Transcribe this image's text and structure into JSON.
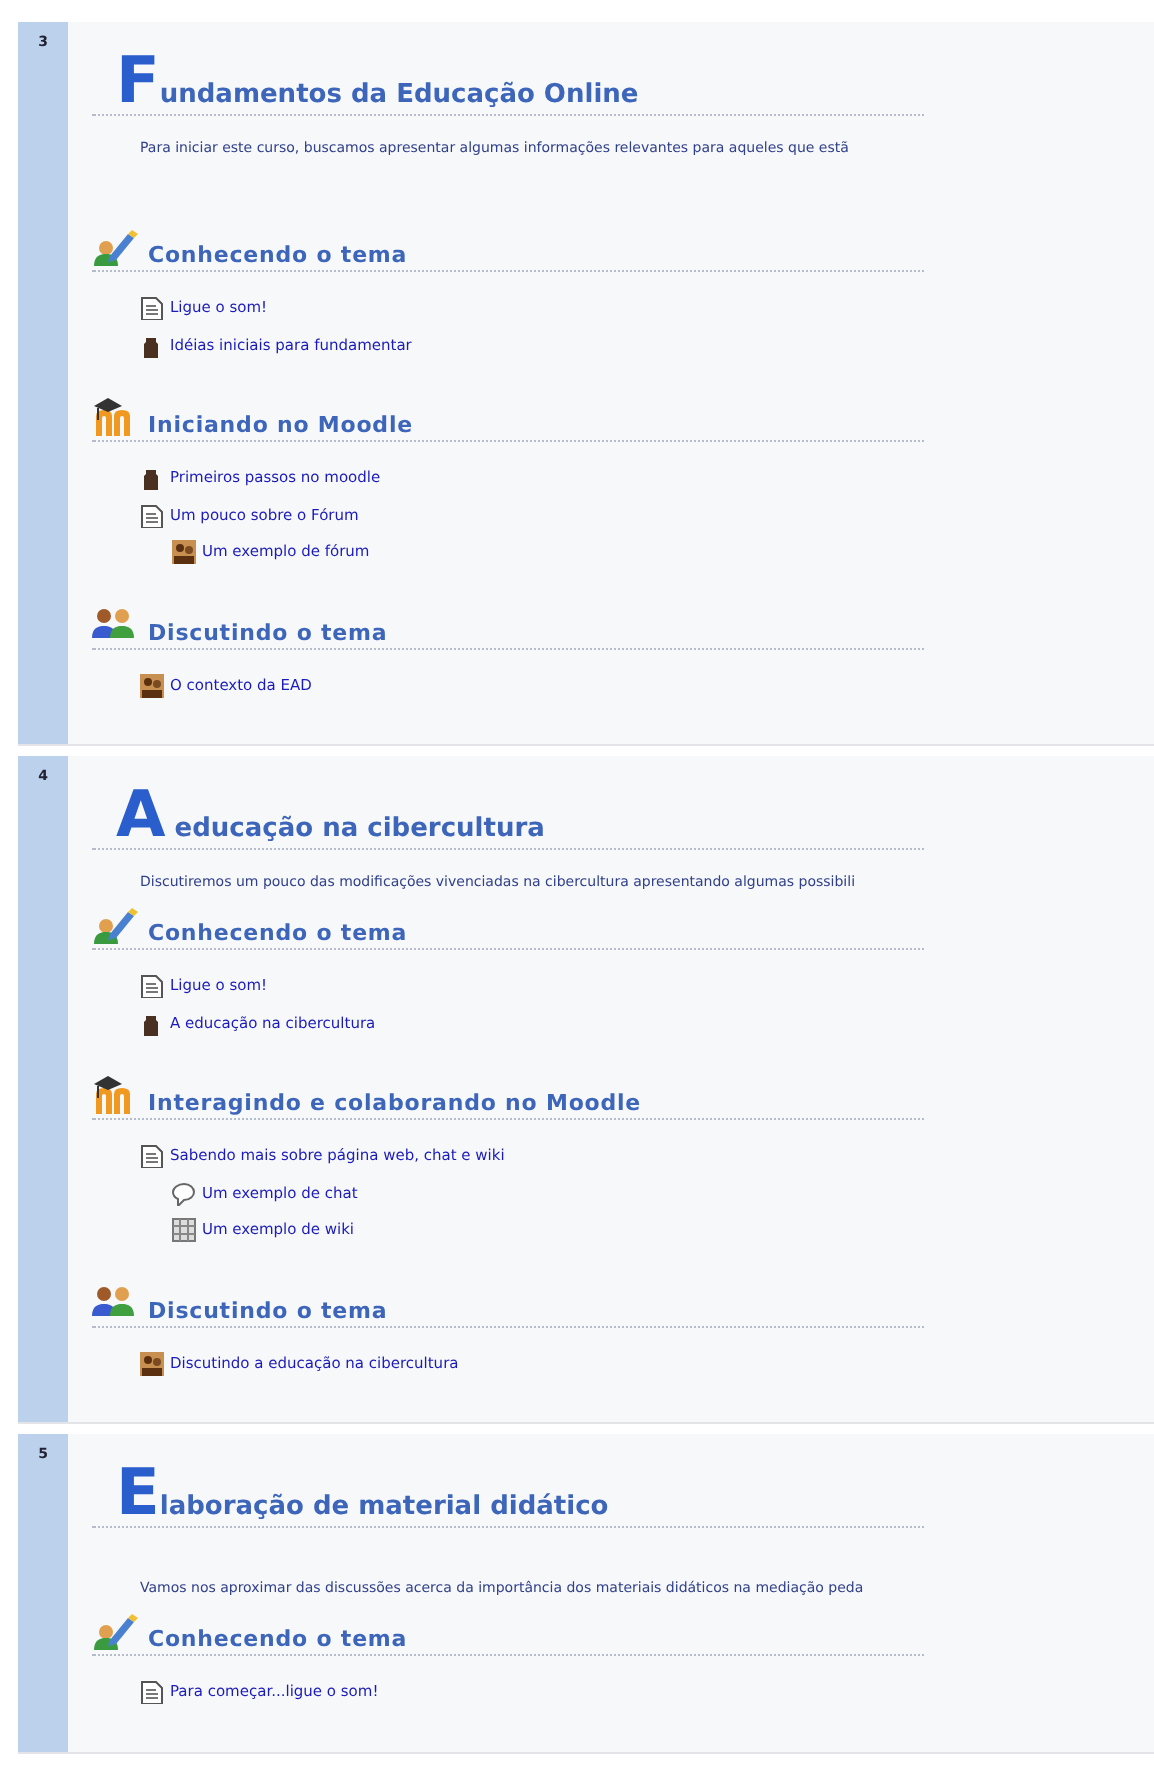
{
  "sections": [
    {
      "number": "3",
      "title": "Fundamentos da Educação Online",
      "intro": "Para iniciar este curso, buscamos apresentar algumas informações relevantes para aqueles que estã",
      "groups": [
        {
          "kind": "topic",
          "heading": "Conhecendo o tema",
          "items": [
            {
              "kind": "page",
              "label": "Ligue o som!"
            },
            {
              "kind": "file",
              "label": "Idéias iniciais para fundamentar"
            }
          ]
        },
        {
          "kind": "moodle",
          "heading": "Iniciando no Moodle",
          "items": [
            {
              "kind": "file",
              "label": "Primeiros passos no moodle"
            },
            {
              "kind": "page",
              "label": "Um pouco sobre o Fórum",
              "children": [
                {
                  "kind": "forum",
                  "label": "Um exemplo de fórum"
                }
              ]
            }
          ]
        },
        {
          "kind": "discussion",
          "heading": "Discutindo o tema",
          "items": [
            {
              "kind": "forum",
              "label": "O contexto da EAD"
            }
          ]
        }
      ]
    },
    {
      "number": "4",
      "title": "A educação na cibercultura",
      "intro": "Discutiremos um pouco das modificações vivenciadas na cibercultura apresentando algumas possibili",
      "groups": [
        {
          "kind": "topic",
          "heading": "Conhecendo o tema",
          "items": [
            {
              "kind": "page",
              "label": "Ligue o som!"
            },
            {
              "kind": "file",
              "label": "A educação na cibercultura"
            }
          ]
        },
        {
          "kind": "moodle",
          "heading": "Interagindo e colaborando no Moodle",
          "items": [
            {
              "kind": "page",
              "label": "Sabendo mais sobre página web, chat e wiki",
              "children": [
                {
                  "kind": "chat",
                  "label": "Um exemplo de chat"
                },
                {
                  "kind": "wiki",
                  "label": "Um exemplo de wiki"
                }
              ]
            }
          ]
        },
        {
          "kind": "discussion",
          "heading": "Discutindo o tema",
          "items": [
            {
              "kind": "forum",
              "label": "Discutindo a educação na cibercultura"
            }
          ]
        }
      ]
    },
    {
      "number": "5",
      "title": "Elaboração de material didático",
      "intro": "Vamos nos aproximar das discussões acerca da importância dos materiais didáticos na mediação peda",
      "groups": [
        {
          "kind": "topic",
          "heading": "Conhecendo o tema",
          "items": [
            {
              "kind": "page",
              "label": "Para começar...ligue o som!"
            }
          ]
        }
      ]
    }
  ]
}
